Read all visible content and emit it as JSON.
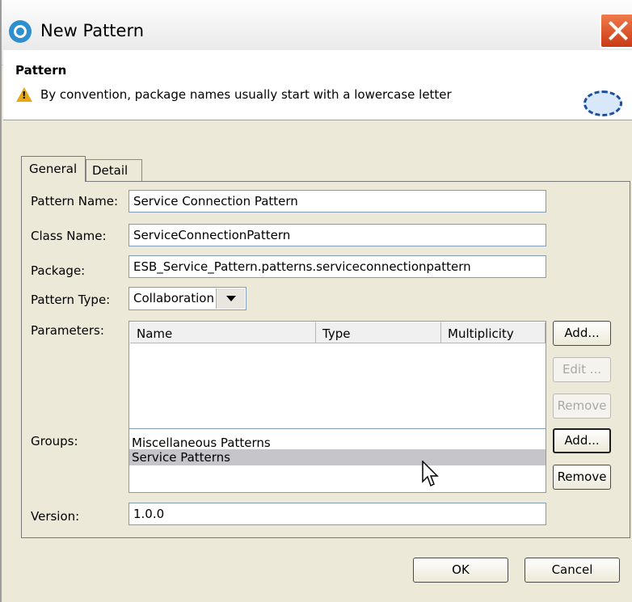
{
  "window": {
    "title": "New Pattern",
    "icons": {
      "app": "eclipse-swirl-icon",
      "close": "close-x-icon"
    }
  },
  "banner": {
    "title": "Pattern",
    "message": "By convention, package names usually start with a lowercase letter",
    "icon": "warning-icon",
    "graphic": "dashed-ellipse-icon"
  },
  "tabs": [
    {
      "label": "General",
      "active": true
    },
    {
      "label": "Detail",
      "active": false
    }
  ],
  "form": {
    "pattern_name_label": "Pattern Name:",
    "pattern_name_value": "Service Connection Pattern",
    "class_name_label": "Class Name:",
    "class_name_value": "ServiceConnectionPattern",
    "package_label": "Package:",
    "package_value": "ESB_Service_Pattern.patterns.serviceconnectionpattern",
    "pattern_type_label": "Pattern Type:",
    "pattern_type_value": "Collaboration",
    "parameters_label": "Parameters:",
    "parameters_columns": [
      "Name",
      "Type",
      "Multiplicity"
    ],
    "groups_label": "Groups:",
    "groups": [
      {
        "label": "Miscellaneous Patterns",
        "selected": false
      },
      {
        "label": "Service Patterns",
        "selected": true
      }
    ],
    "version_label": "Version:",
    "version_value": "1.0.0"
  },
  "buttons": {
    "params_add": "Add...",
    "params_edit": "Edit ...",
    "params_remove": "Remove",
    "groups_add": "Add...",
    "groups_remove": "Remove",
    "ok": "OK",
    "cancel": "Cancel"
  }
}
